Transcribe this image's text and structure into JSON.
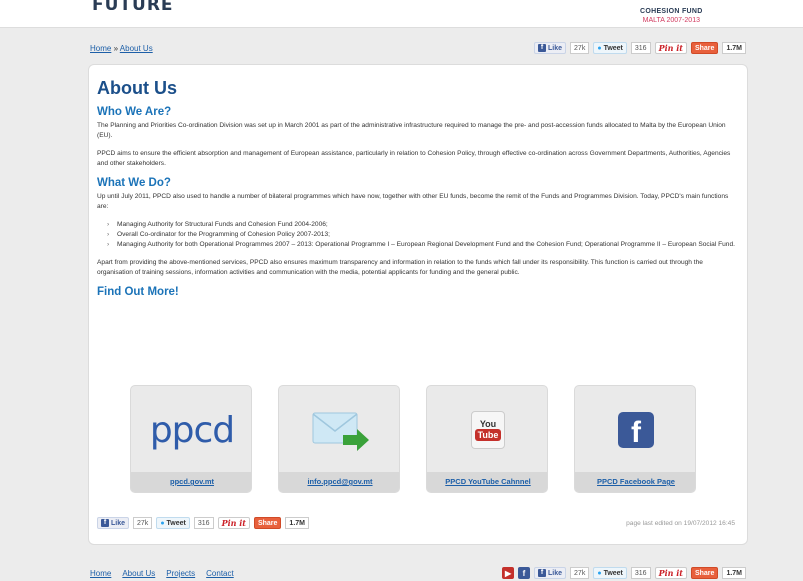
{
  "header": {
    "logo_text": "FUTURE",
    "cohesion_line1": "COHESION FUND",
    "cohesion_line2": "MALTA 2007-2013"
  },
  "breadcrumb": {
    "home": "Home",
    "sep": " » ",
    "current": "About Us"
  },
  "share": {
    "like": "Like",
    "like_count": "27k",
    "tweet": "Tweet",
    "tweet_count": "316",
    "pin": "Pin it",
    "share": "Share",
    "total": "1.7M"
  },
  "content": {
    "title": "About Us",
    "h_who": "Who We Are?",
    "p_who_1": "The Planning and Priorities Co-ordination Division was set up in March 2001 as part of the administrative infrastructure required to manage the pre- and post-accession funds allocated to Malta by the European Union (EU).",
    "p_who_2": "PPCD aims to ensure the efficient absorption and management of European assistance, particularly in relation to Cohesion Policy, through effective co-ordination across Government Departments, Authorities, Agencies and other stakeholders.",
    "h_what": "What We Do?",
    "p_what_1": "Up until July 2011, PPCD also used to handle a number of bilateral programmes which have now, together with other EU funds, become the remit of the Funds and Programmes Division. Today, PPCD's main functions are:",
    "functions": [
      "Managing Authority for Structural Funds and Cohesion Fund 2004-2006;",
      "Overall Co-ordinator for the Programming of Cohesion Policy 2007-2013;",
      "Managing Authority for both Operational Programmes 2007 – 2013: Operational Programme I – European Regional Development Fund and the Cohesion Fund; Operational Programme II – European Social Fund."
    ],
    "p_what_2": "Apart from providing the above-mentioned services, PPCD also ensures maximum transparency and information in relation to the funds which fall under its responsibility. This function is carried out through the organisation of training sessions, information activities and communication with the media, potential applicants for funding and the general public.",
    "h_find": "Find Out More!"
  },
  "link_cards": {
    "ppcd_logo": "ppcd",
    "ppcd_link": "ppcd.gov.mt",
    "email_link": "info.ppcd@gov.mt",
    "youtube_link": "PPCD YouTube Cahnnel",
    "youtube_logo_top": "You",
    "youtube_logo_bottom": "Tube",
    "facebook_link": "PPCD Facebook Page",
    "facebook_logo": "f"
  },
  "edited": "page last edited on 19/07/2012 16:45",
  "footer": {
    "home": "Home",
    "about": "About Us",
    "projects": "Projects",
    "contact": "Contact"
  },
  "colors": {
    "accent": "#1b4f8a",
    "link": "#1d5fa8",
    "facebook": "#3b5998",
    "share": "#e8603c"
  }
}
